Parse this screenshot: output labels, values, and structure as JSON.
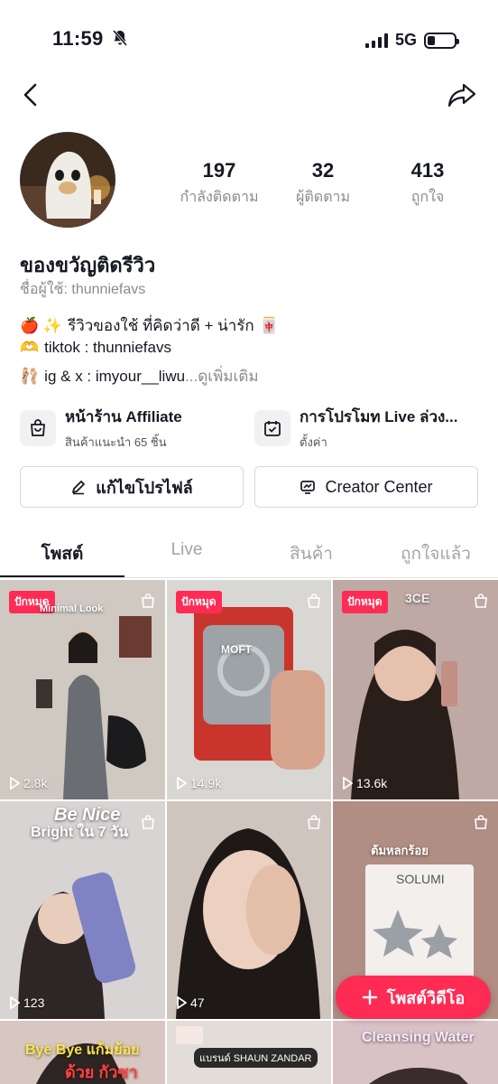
{
  "status_bar": {
    "time": "11:59",
    "network": "5G"
  },
  "profile": {
    "stats": [
      {
        "value": "197",
        "label": "กำลังติดตาม"
      },
      {
        "value": "32",
        "label": "ผู้ติดตาม"
      },
      {
        "value": "413",
        "label": "ถูกใจ"
      }
    ],
    "display_name": "ของขวัญติดรีวิว",
    "username_line": "ชื่อผู้ใช้: thunniefavs",
    "bio": [
      {
        "emoji": "🍎 ✨",
        "text": "รีวิวของใช้ ที่คิดว่าดี + น่ารัก",
        "emoji_after": "🀄"
      },
      {
        "emoji": "🫶",
        "text": "tiktok : thunniefavs"
      },
      {
        "emoji": "🩰",
        "text": "ig & x : imyour__liwu",
        "more": "...ดูเพิ่มเติม"
      }
    ]
  },
  "shortcuts": [
    {
      "title": "หน้าร้าน Affiliate",
      "subtitle": "สินค้าแนะนำ 65 ชิ้น"
    },
    {
      "title": "การโปรโมท Live ล่วง...",
      "subtitle": "ตั้งค่า"
    }
  ],
  "buttons": {
    "edit_profile": "แก้ไขโปรไฟล์",
    "creator_center": "Creator Center"
  },
  "tabs": [
    "โพสต์",
    "Live",
    "สินค้า",
    "ถูกใจแล้ว"
  ],
  "videos": [
    {
      "views": "2.8k",
      "badge": "ปักหมุด",
      "caption": "Minimal Look"
    },
    {
      "views": "14.9k",
      "badge": "ปักหมุด",
      "caption": "MOFT"
    },
    {
      "views": "13.6k",
      "badge": "ปักหมุด",
      "caption": "3CE"
    },
    {
      "views": "123",
      "badge": "",
      "caption": "Be Nice",
      "caption2": "Bright ใน 7 วัน"
    },
    {
      "views": "47",
      "badge": "",
      "caption": ""
    },
    {
      "views": "",
      "badge": "",
      "caption": "ต้มหลกร้อย",
      "caption2": "SOLUMI"
    },
    {
      "views": "",
      "badge": "",
      "caption": "Bye Bye แก้มย้อย",
      "caption2": "ด้วย กัวซา"
    },
    {
      "views": "",
      "badge": "",
      "caption": "แบรนด์ SHAUN ZANDAR"
    },
    {
      "views": "",
      "badge": "",
      "caption": "Cleansing Water"
    }
  ],
  "fab": {
    "label": "โพสต์วิดีโอ"
  },
  "colors": {
    "accent": "#fe2c55",
    "text": "#161823",
    "secondary": "#8a8b91"
  }
}
